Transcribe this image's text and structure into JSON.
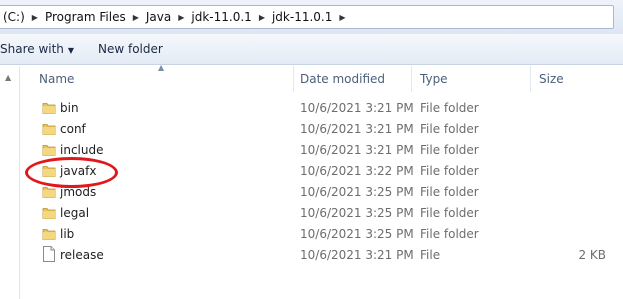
{
  "address": {
    "crumbs": [
      "(C:)",
      "Program Files",
      "Java",
      "jdk-11.0.1",
      "jdk-11.0.1"
    ]
  },
  "toolbar": {
    "share_label": "Share with",
    "new_folder_label": "New folder"
  },
  "columns": {
    "name": "Name",
    "date": "Date modified",
    "type": "Type",
    "size": "Size"
  },
  "files": [
    {
      "name": "bin",
      "date": "10/6/2021 3:21 PM",
      "type": "File folder",
      "size": "",
      "icon": "folder-icon"
    },
    {
      "name": "conf",
      "date": "10/6/2021 3:21 PM",
      "type": "File folder",
      "size": "",
      "icon": "folder-icon"
    },
    {
      "name": "include",
      "date": "10/6/2021 3:21 PM",
      "type": "File folder",
      "size": "",
      "icon": "folder-icon"
    },
    {
      "name": "javafx",
      "date": "10/6/2021 3:22 PM",
      "type": "File folder",
      "size": "",
      "icon": "folder-icon"
    },
    {
      "name": "jmods",
      "date": "10/6/2021 3:25 PM",
      "type": "File folder",
      "size": "",
      "icon": "folder-icon"
    },
    {
      "name": "legal",
      "date": "10/6/2021 3:25 PM",
      "type": "File folder",
      "size": "",
      "icon": "folder-icon"
    },
    {
      "name": "lib",
      "date": "10/6/2021 3:25 PM",
      "type": "File folder",
      "size": "",
      "icon": "folder-icon"
    },
    {
      "name": "release",
      "date": "10/6/2021 3:21 PM",
      "type": "File",
      "size": "2 KB",
      "icon": "file-icon"
    }
  ],
  "colors": {
    "annotation": "#e0181c",
    "folder": "#e8c25a"
  }
}
